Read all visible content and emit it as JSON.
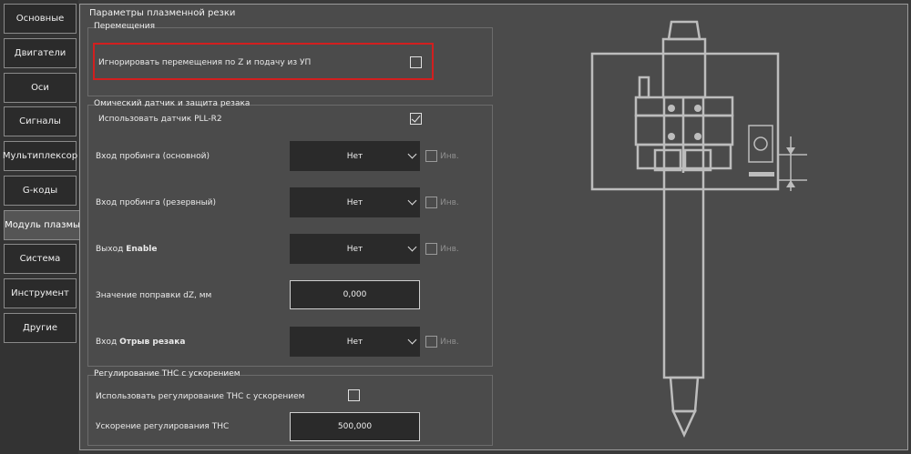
{
  "sidebar": {
    "items": [
      {
        "label": "Основные"
      },
      {
        "label": "Двигатели"
      },
      {
        "label": "Оси"
      },
      {
        "label": "Сигналы"
      },
      {
        "label": "Мультиплексор"
      },
      {
        "label": "G-коды"
      },
      {
        "label": "Модуль плазмы"
      },
      {
        "label": "Система"
      },
      {
        "label": "Инструмент"
      },
      {
        "label": "Другие"
      }
    ],
    "active_index": 6
  },
  "page": {
    "title": "Параметры плазменной резки"
  },
  "group_moves": {
    "title": "Перемещения",
    "ignore_label": "Игнорировать перемещения по Z и подачу из УП",
    "ignore_checked": false
  },
  "group_ohmic": {
    "title": "Омический датчик и защита резака",
    "use_sensor_label": "Использовать датчик PLL-R2",
    "use_sensor_checked": true,
    "probe_main": {
      "label": "Вход пробинга (основной)",
      "value": "Нет",
      "inv": "Инв."
    },
    "probe_reserve": {
      "label": "Вход пробинга (резервный)",
      "value": "Нет",
      "inv": "Инв."
    },
    "enable_out": {
      "label_prefix": "Выход ",
      "label_bold": "Enable",
      "value": "Нет",
      "inv": "Инв."
    },
    "dz": {
      "label": "Значение поправки dZ, мм",
      "value": "0,000"
    },
    "torch_break": {
      "label_prefix": "Вход ",
      "label_bold": "Отрыв резака",
      "value": "Нет",
      "inv": "Инв."
    }
  },
  "group_thc": {
    "title": "Регулирование THC с ускорением",
    "use_label": "Использовать регулирование THC с ускорением",
    "use_checked": false,
    "accel_label": "Ускорение регулирования THC",
    "accel_value": "500,000"
  }
}
